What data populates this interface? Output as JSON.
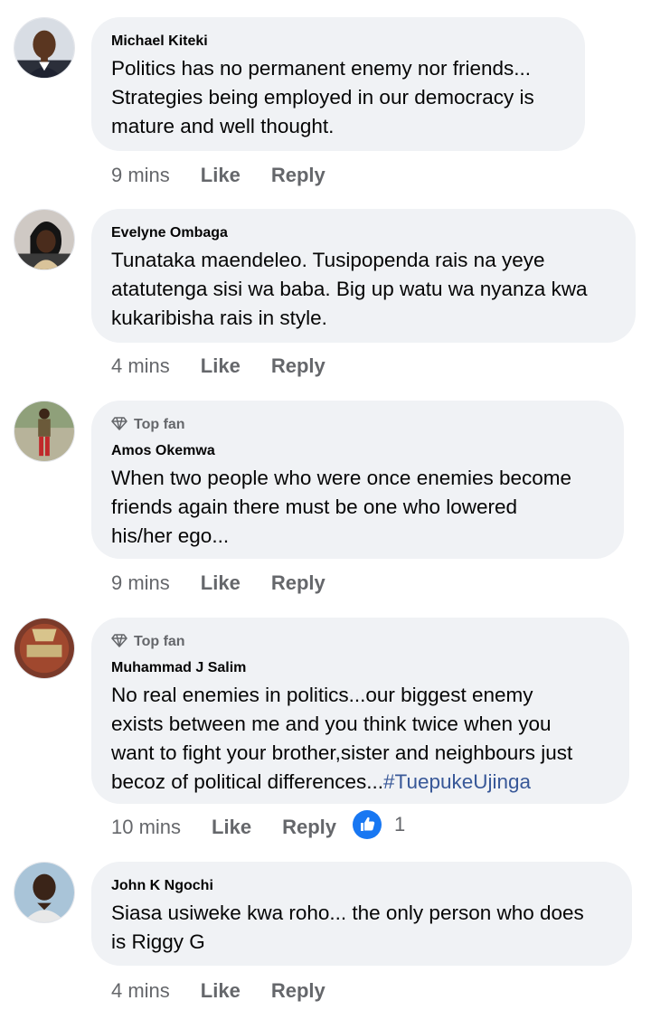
{
  "comments": [
    {
      "author": "Michael Kiteki",
      "badge": "",
      "text": "Politics has no permanent enemy nor friends...\nStrategies being employed in our democracy is\nmature and well thought.",
      "time": "9 mins",
      "like_label": "Like",
      "reply_label": "Reply"
    },
    {
      "author": "Evelyne Ombaga",
      "badge": "",
      "text": "Tunataka maendeleo. Tusipopenda rais na yeye\natatutenga sisi wa baba. Big up watu wa nyanza kwa\nkukaribisha rais in style.",
      "time": "4 mins",
      "like_label": "Like",
      "reply_label": "Reply"
    },
    {
      "author": "Amos Okemwa",
      "badge": "Top fan",
      "text": "When two people who were once enemies become\nfriends again there must be one who lowered\nhis/her ego...",
      "time": "9 mins",
      "like_label": "Like",
      "reply_label": "Reply"
    },
    {
      "author": "Muhammad J Salim",
      "badge": "Top fan",
      "text": "No real enemies in politics...our biggest enemy\nexists between me and you think twice when you\nwant to fight your brother,sister and neighbours just\nbecoz of political differences...",
      "hashtag": "#TuepukeUjinga",
      "time": "10 mins",
      "like_label": "Like",
      "reply_label": "Reply",
      "reaction_icon": "like-reaction-icon",
      "reaction_count": "1"
    },
    {
      "author": "John K Ngochi",
      "badge": "",
      "text": "Siasa usiweke kwa roho... the only person who does\nis Riggy G",
      "time": "4 mins",
      "like_label": "Like",
      "reply_label": "Reply"
    }
  ],
  "colors": {
    "bubble": "#f0f2f5",
    "secondary_text": "#65676b",
    "hashtag": "#385898",
    "like_blue": "#1877f2"
  }
}
